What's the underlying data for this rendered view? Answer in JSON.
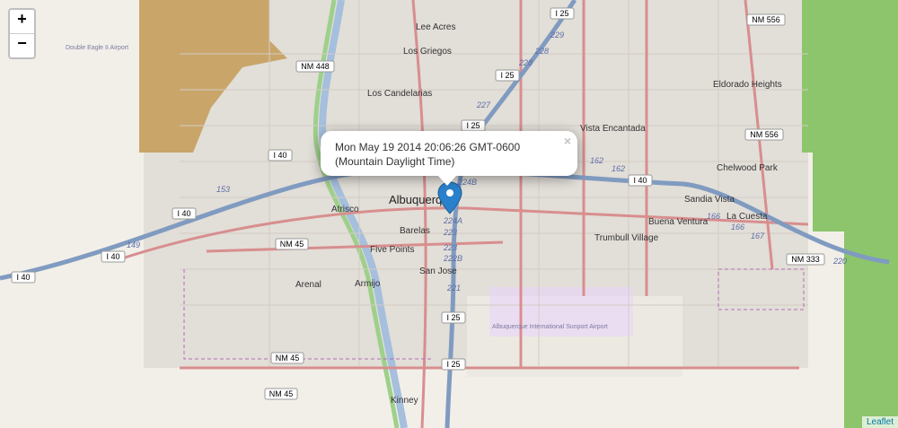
{
  "map": {
    "zoom_in": "+",
    "zoom_out": "−",
    "attribution": "Leaflet",
    "popup_text": "Mon May 19 2014 20:06:26 GMT-0600 (Mountain Daylight Time)",
    "popup_close": "×",
    "labels": {
      "lee_acres": "Lee Acres",
      "los_griegos": "Los Griegos",
      "los_candelarias": "Los Candelarias",
      "eldorado": "Eldorado Heights",
      "vista": "Vista Encantada",
      "chelwood": "Chelwood Park",
      "sandia": "Sandia Vista",
      "buena": "Buena Ventura",
      "la_cuesta": "La Cuesta",
      "trumbull": "Trumbull Village",
      "albuquerque": "Albuquerque",
      "atrisco": "Atrisco",
      "barelas": "Barelas",
      "five_points": "Five Points",
      "san_jose": "San Jose",
      "arenal": "Arenal",
      "armijo": "Armijo",
      "kinney": "Kinney",
      "airport": "Albuquerque International Sunport Airport",
      "double_eagle": "Double Eagle II Airport"
    },
    "shields": {
      "i25": "I 25",
      "i40": "I 40",
      "nm556": "NM 556",
      "nm448": "NM 448",
      "nm45": "NM 45",
      "nm333": "NM 333"
    },
    "exits": {
      "e229": "229",
      "e228": "228",
      "e227": "227",
      "e162": "162",
      "e153": "153",
      "e149": "149",
      "e166": "166",
      "e167": "167",
      "e224b": "224B",
      "e224a": "224A",
      "e223": "223",
      "e222b": "222B",
      "e221": "221",
      "e220": "220"
    }
  }
}
